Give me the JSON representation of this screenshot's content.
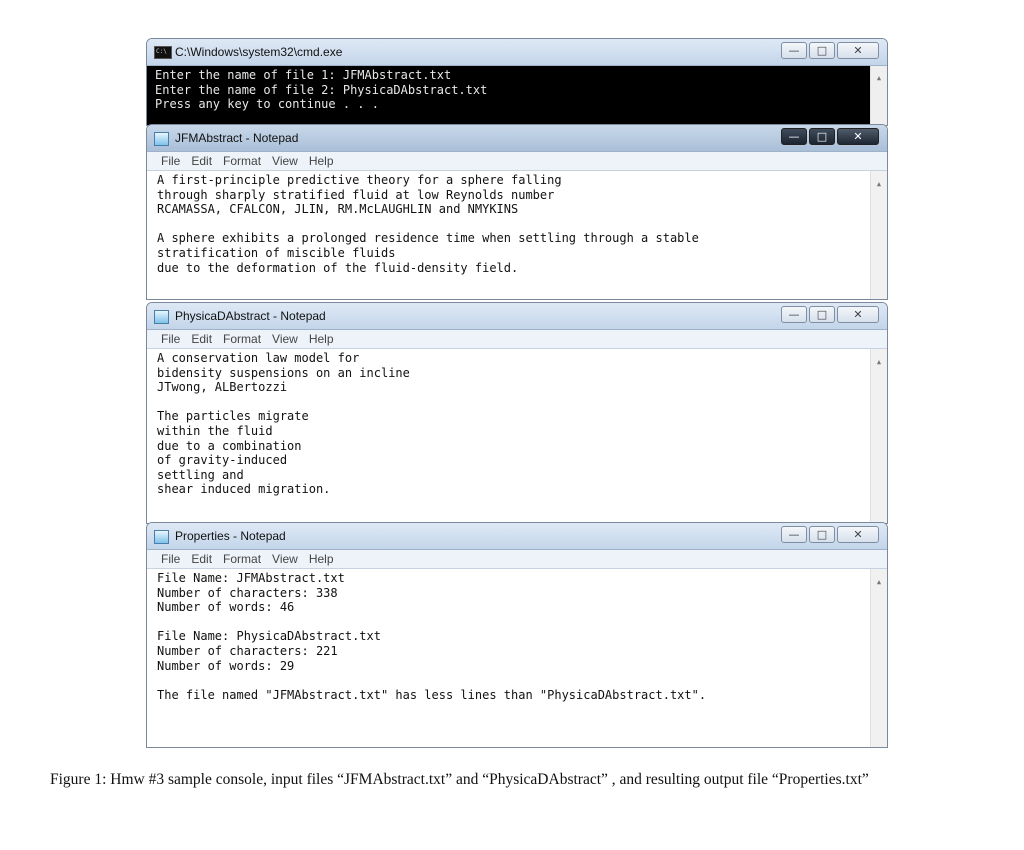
{
  "cmd": {
    "title": "C:\\Windows\\system32\\cmd.exe",
    "lines": [
      "Enter the name of file 1: JFMAbstract.txt",
      "Enter the name of file 2: PhysicaDAbstract.txt",
      "Press any key to continue . . ."
    ]
  },
  "menu": [
    "File",
    "Edit",
    "Format",
    "View",
    "Help"
  ],
  "window_buttons": {
    "minimize": "—",
    "maximize": "□",
    "close": "✕"
  },
  "jfm": {
    "title": "JFMAbstract - Notepad",
    "lines": [
      "A first-principle predictive theory for a sphere falling",
      "through sharply stratified fluid at low Reynolds number",
      "RCAMASSA, CFALCON, JLIN, RM.McLAUGHLIN and NMYKINS",
      "",
      "A sphere exhibits a prolonged residence time when settling through a stable",
      "stratification of miscible fluids",
      "due to the deformation of the fluid-density field."
    ]
  },
  "physica": {
    "title": "PhysicaDAbstract - Notepad",
    "lines": [
      "A conservation law model for",
      "bidensity suspensions on an incline",
      "JTwong, ALBertozzi",
      "",
      "The particles migrate",
      "within the fluid",
      "due to a combination",
      "of gravity-induced",
      "settling and",
      "shear induced migration."
    ]
  },
  "properties": {
    "title": "Properties - Notepad",
    "lines": [
      "File Name: JFMAbstract.txt",
      "Number of characters: 338",
      "Number of words: 46",
      "",
      "File Name: PhysicaDAbstract.txt",
      "Number of characters: 221",
      "Number of words: 29",
      "",
      "The file named \"JFMAbstract.txt\" has less lines than \"PhysicaDAbstract.txt\"."
    ]
  },
  "caption": "Figure 1: Hmw #3 sample console, input files “JFMAbstract.txt” and “PhysicaDAbstract” , and resulting output file “Properties.txt”"
}
